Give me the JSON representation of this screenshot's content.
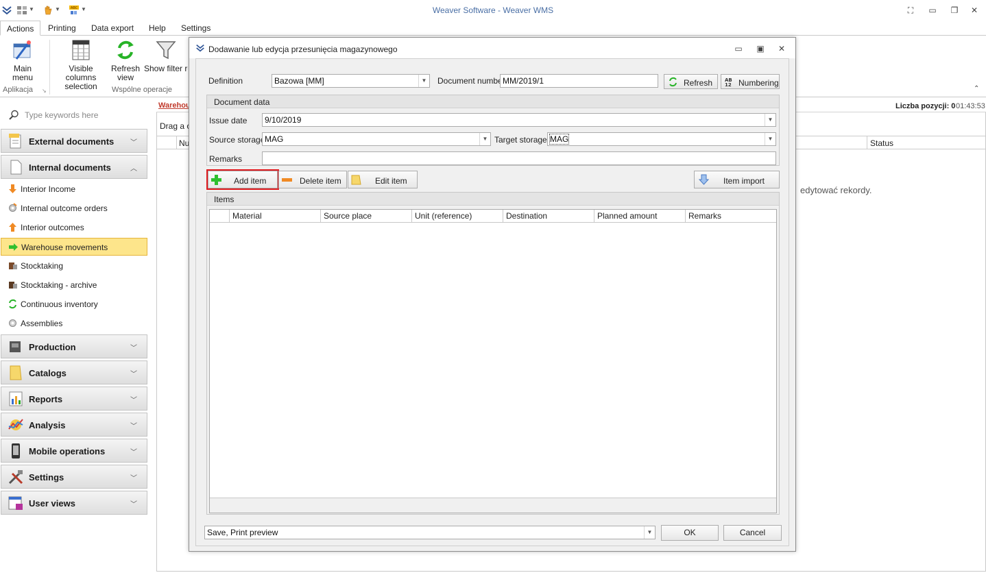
{
  "app": {
    "title": "Weaver Software - Weaver WMS"
  },
  "ribbon": {
    "tabs": [
      "Actions",
      "Printing",
      "Data export",
      "Help",
      "Settings"
    ],
    "buttons": {
      "main_menu": "Main menu",
      "visible_columns_1": "Visible columns",
      "visible_columns_2": "selection",
      "refresh_1": "Refresh",
      "refresh_2": "view",
      "show_filter": "Show filter ro"
    },
    "groups": {
      "aplikacja": "Aplikacja",
      "wspolne": "Wspólne operacje"
    }
  },
  "sidebar": {
    "search_placeholder": "Type keywords here",
    "sections": {
      "external": "External documents",
      "internal": "Internal documents",
      "production": "Production",
      "catalogs": "Catalogs",
      "reports": "Reports",
      "analysis": "Analysis",
      "mobile": "Mobile operations",
      "settings": "Settings",
      "user_views": "User views"
    },
    "items": [
      "Interior Income",
      "Internal outcome orders",
      "Interior outcomes",
      "Warehouse movements",
      "Stocktaking",
      "Stocktaking - archive",
      "Continuous inventory",
      "Assemblies"
    ]
  },
  "background": {
    "breadcrumb": "Warehou",
    "count_label": "Liczba pozycji: 0",
    "time": "01:43:53",
    "drag_text": "Drag a c",
    "col_nu": "Nu",
    "col_status": "Status",
    "message": "edytować rekordy."
  },
  "dialog": {
    "title": "Dodawanie lub edycja przesunięcia magazynowego",
    "definition_label": "Definition",
    "definition_value": "Bazowa [MM]",
    "docnum_label": "Document number",
    "docnum_value": "MM/2019/1",
    "refresh_label": "Refresh",
    "numbering_label": "Numbering",
    "document_data_title": "Document data",
    "issue_date_label": "Issue date",
    "issue_date_value": "9/10/2019",
    "source_storage_label": "Source storage",
    "source_storage_value": "MAG",
    "target_storage_label": "Target storage",
    "target_storage_value": "MAG",
    "remarks_label": "Remarks",
    "remarks_value": "",
    "add_item": "Add item",
    "delete_item": "Delete item",
    "edit_item": "Edit item",
    "item_import": "Item import",
    "items_title": "Items",
    "columns": [
      "Material",
      "Source place",
      "Unit (reference)",
      "Destination",
      "Planned amount",
      "Remarks"
    ],
    "save_option": "Save, Print preview",
    "ok": "OK",
    "cancel": "Cancel"
  }
}
